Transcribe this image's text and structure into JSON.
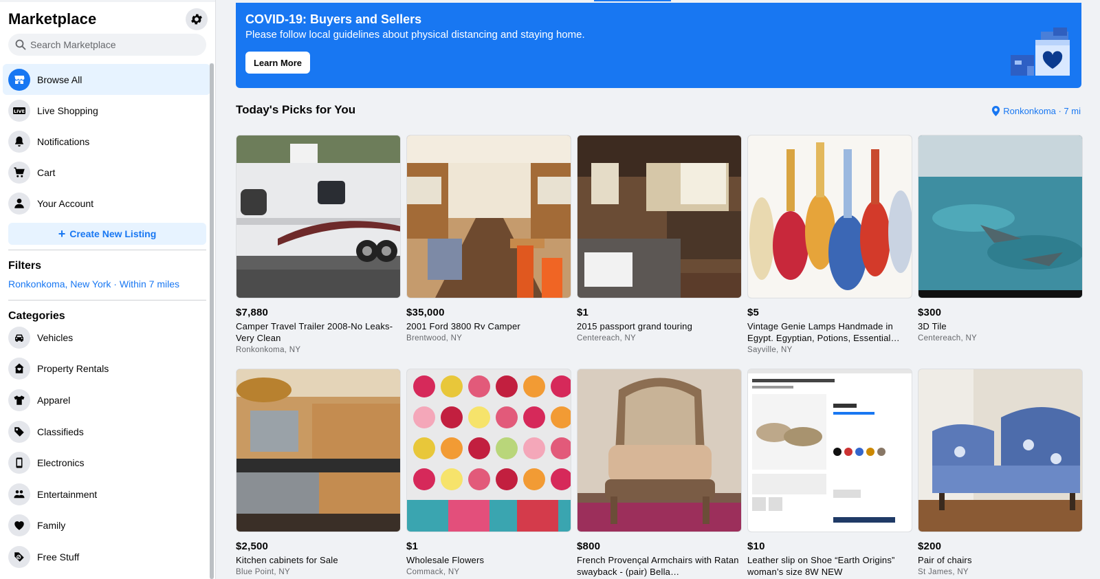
{
  "sidebar": {
    "title": "Marketplace",
    "search_placeholder": "Search Marketplace",
    "nav": [
      {
        "label": "Browse All",
        "icon": "storefront-icon"
      },
      {
        "label": "Live Shopping",
        "icon": "live-icon"
      },
      {
        "label": "Notifications",
        "icon": "bell-icon"
      },
      {
        "label": "Cart",
        "icon": "cart-icon"
      },
      {
        "label": "Your Account",
        "icon": "person-icon"
      }
    ],
    "create_listing": "Create New Listing",
    "filters_heading": "Filters",
    "filter_location": "Ronkonkoma, New York · Within 7 miles",
    "categories_heading": "Categories",
    "categories": [
      {
        "label": "Vehicles",
        "icon": "car-icon"
      },
      {
        "label": "Property Rentals",
        "icon": "house-icon"
      },
      {
        "label": "Apparel",
        "icon": "shirt-icon"
      },
      {
        "label": "Classifieds",
        "icon": "tag-icon"
      },
      {
        "label": "Electronics",
        "icon": "phone-icon"
      },
      {
        "label": "Entertainment",
        "icon": "people-icon"
      },
      {
        "label": "Family",
        "icon": "heart-icon"
      },
      {
        "label": "Free Stuff",
        "icon": "free-tag-icon"
      }
    ]
  },
  "banner": {
    "title": "COVID-19: Buyers and Sellers",
    "text": "Please follow local guidelines about physical distancing and staying home.",
    "button": "Learn More"
  },
  "picks": {
    "title": "Today's Picks for You",
    "location": "Ronkonkoma · 7 mi",
    "items": [
      {
        "price": "$7,880",
        "title": "Camper Travel Trailer 2008-No Leaks-Very Clean",
        "location": "Ronkonkoma, NY",
        "image": "camper-trailer"
      },
      {
        "price": "$35,000",
        "title": "2001 Ford 3800 Rv Camper",
        "location": "Brentwood, NY",
        "image": "bus-interior"
      },
      {
        "price": "$1",
        "title": "2015 passport grand touring",
        "location": "Centereach, NY",
        "image": "rv-interior"
      },
      {
        "price": "$5",
        "title": "Vintage Genie Lamps Handmade in Egypt. Egyptian, Potions, Essential…",
        "location": "Sayville, NY",
        "image": "genie-bottles"
      },
      {
        "price": "$300",
        "title": "3D Tile",
        "location": "Centereach, NY",
        "image": "ocean-floor"
      },
      {
        "price": "$2,500",
        "title": "Kitchen cabinets for Sale",
        "location": "Blue Point, NY",
        "image": "kitchen"
      },
      {
        "price": "$1",
        "title": "Wholesale Flowers",
        "location": "Commack, NY",
        "image": "roses"
      },
      {
        "price": "$800",
        "title": "French Provençal Armchairs with Ratan swayback - (pair) Bella…",
        "location": "",
        "image": "armchair"
      },
      {
        "price": "$10",
        "title": "Leather slip on Shoe “Earth Origins” woman’s size 8W NEW",
        "location": "",
        "image": "shoe-listing"
      },
      {
        "price": "$200",
        "title": "Pair of chairs",
        "location": "St James, NY",
        "image": "blue-chairs"
      }
    ]
  },
  "colors": {
    "accent": "#1877f2",
    "accent_light": "#e7f3ff",
    "bg": "#f0f2f5",
    "secondary_text": "#65676b"
  }
}
